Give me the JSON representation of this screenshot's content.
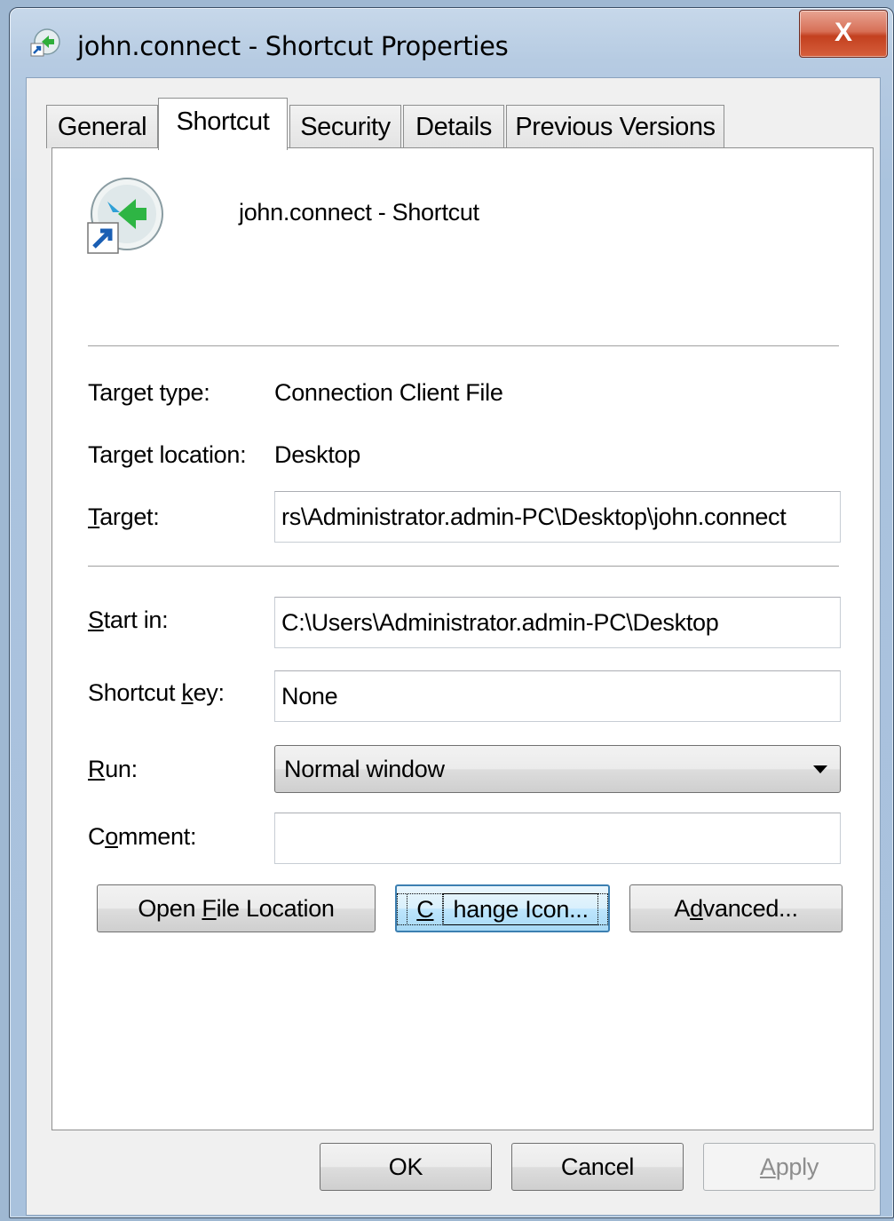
{
  "window": {
    "title": "john.connect - Shortcut Properties",
    "close_label": "X"
  },
  "tabs": [
    {
      "label": "General"
    },
    {
      "label": "Shortcut"
    },
    {
      "label": "Security"
    },
    {
      "label": "Details"
    },
    {
      "label": "Previous Versions"
    }
  ],
  "active_tab": "Shortcut",
  "header": {
    "file_name": "john.connect - Shortcut"
  },
  "fields": {
    "target_type": {
      "label": "Target type:",
      "value": "Connection Client File"
    },
    "target_location": {
      "label": "Target location:",
      "value": "Desktop"
    },
    "target": {
      "label_pre": "",
      "label_u": "T",
      "label_post": "arget:",
      "value": "rs\\Administrator.admin-PC\\Desktop\\john.connect"
    },
    "start_in": {
      "label_u": "S",
      "label_post": "tart in:",
      "value": "C:\\Users\\Administrator.admin-PC\\Desktop"
    },
    "shortcut_key": {
      "label_pre": "Shortcut ",
      "label_u": "k",
      "label_post": "ey:",
      "value": "None"
    },
    "run": {
      "label_u": "R",
      "label_post": "un:",
      "value": "Normal window"
    },
    "comment": {
      "label_pre": "C",
      "label_u": "o",
      "label_post": "mment:",
      "value": ""
    }
  },
  "action_buttons": {
    "open_file_location": {
      "pre": "Open ",
      "u": "F",
      "post": "ile Location"
    },
    "change_icon": {
      "pre": "",
      "u": "C",
      "post": "hange Icon..."
    },
    "advanced": {
      "pre": "A",
      "u": "d",
      "post": "vanced..."
    }
  },
  "footer": {
    "ok": "OK",
    "cancel": "Cancel",
    "apply_u": "A",
    "apply_post": "pply"
  },
  "colors": {
    "frame": "#aac3de",
    "close_button": "#c3401f",
    "focus_border": "#3c7fb1"
  },
  "icons": {
    "title": "remote-connection-icon",
    "file": "remote-connection-shortcut-icon"
  }
}
